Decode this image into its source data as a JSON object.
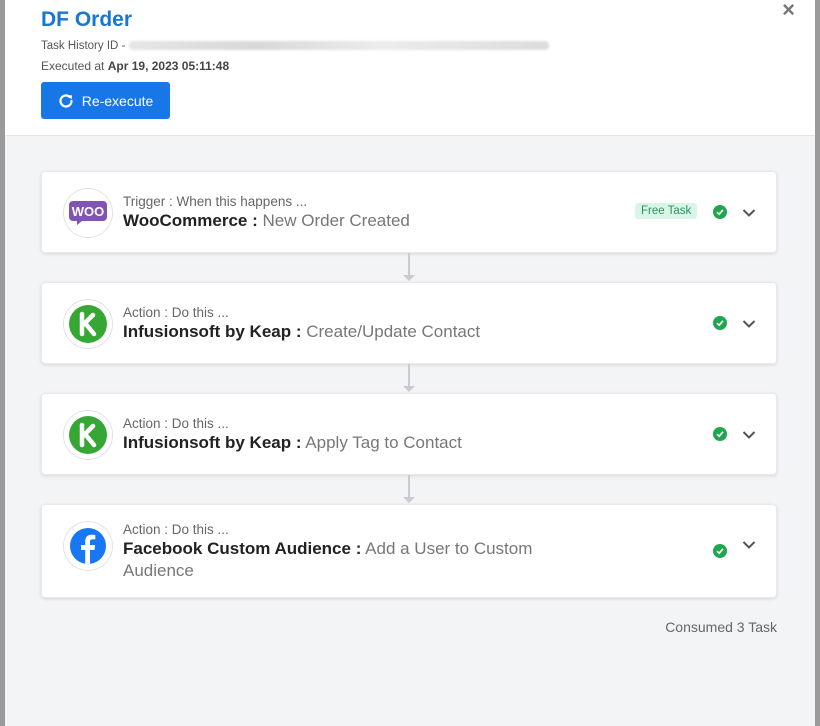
{
  "header": {
    "title": "DF Order",
    "task_history_label": "Task History ID -",
    "executed_label": "Executed at",
    "executed_at": "Apr 19, 2023 05:11:48",
    "reexecute_label": "Re-execute"
  },
  "steps": [
    {
      "subtitle": "Trigger : When this happens ...",
      "app": "WooCommerce :",
      "action": "New Order Created",
      "badge": "Free Task",
      "icon": "woocommerce-logo"
    },
    {
      "subtitle": "Action : Do this ...",
      "app": "Infusionsoft by Keap :",
      "action": "Create/Update Contact",
      "icon": "keap-logo"
    },
    {
      "subtitle": "Action : Do this ...",
      "app": "Infusionsoft by Keap :",
      "action": "Apply Tag to Contact",
      "icon": "keap-logo"
    },
    {
      "subtitle": "Action : Do this ...",
      "app": "Facebook Custom Audience :",
      "action": "Add a User to Custom Audience",
      "icon": "facebook-logo"
    }
  ],
  "footer": {
    "consumed": "Consumed 3 Task"
  },
  "colors": {
    "primary": "#1877e8",
    "success": "#1fa64f",
    "woo": "#7f54b3",
    "keap": "#36a635",
    "facebook": "#1877f2"
  }
}
